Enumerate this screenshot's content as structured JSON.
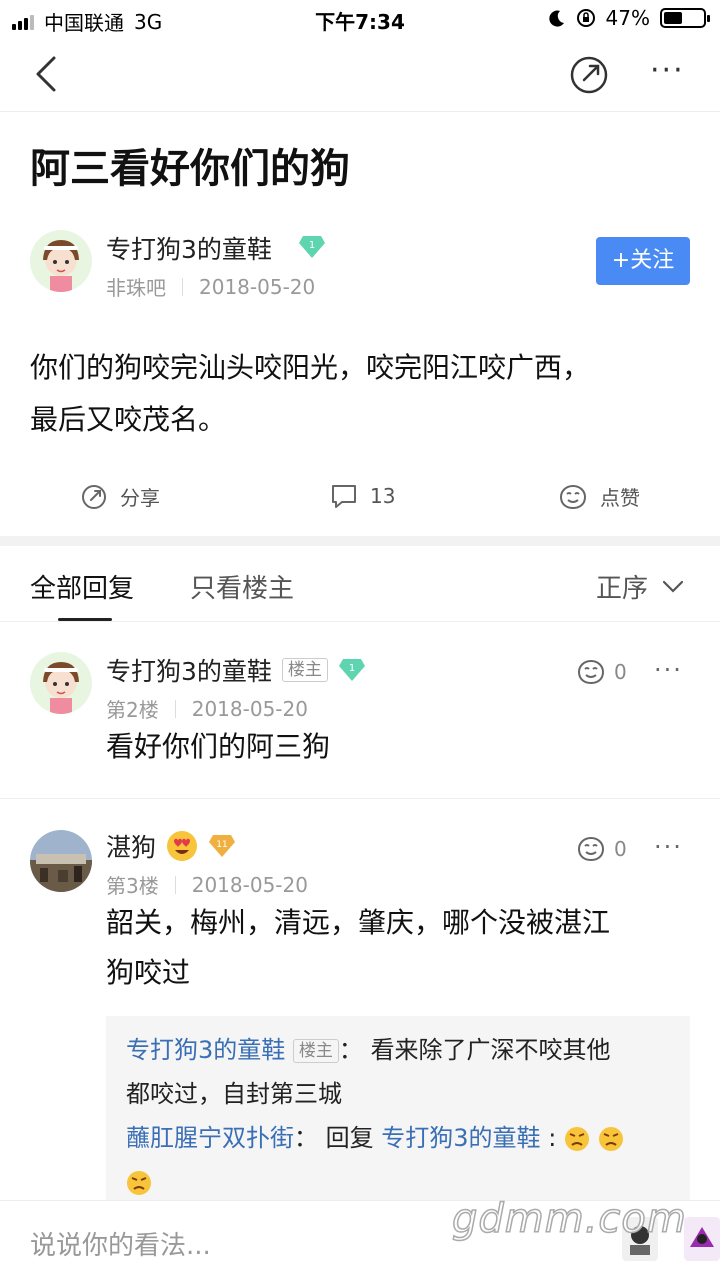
{
  "status_bar": {
    "carrier": "中国联通",
    "network": "3G",
    "time": "下午7:34",
    "battery": "47%",
    "battery_level": 0.47
  },
  "post": {
    "title": "阿三看好你们的狗",
    "author": "专打狗3的童鞋",
    "author_level": "1",
    "forum": "非珠吧",
    "date": "2018-05-20",
    "follow_label": "+关注",
    "body_line1": "你们的狗咬完汕头咬阳光，咬完阳江咬广西，",
    "body_line2": "最后又咬茂名。",
    "share_label": "分享",
    "comment_count": "13",
    "like_label": "点赞"
  },
  "tabs": {
    "all": "全部回复",
    "op_only": "只看楼主",
    "sort": "正序"
  },
  "replies": [
    {
      "author": "专打狗3的童鞋",
      "badge": "楼主",
      "level": "1",
      "floor": "第2楼",
      "date": "2018-05-20",
      "likes": "0",
      "text": "看好你们的阿三狗"
    },
    {
      "author": "湛狗",
      "level": "11",
      "floor": "第3楼",
      "date": "2018-05-20",
      "likes": "0",
      "text_line1": "韶关，梅州，清远，肇庆，哪个没被湛江",
      "text_line2": "狗咬过",
      "sub_replies": [
        {
          "author": "专打狗3的童鞋",
          "badge": "楼主",
          "sep": "：",
          "text_line1": "看来除了广深不咬其他",
          "text_line2": "都咬过，自封第三城"
        },
        {
          "author": "蘸肛腥宁双扑街",
          "sep": "：",
          "reply_prefix": "回复",
          "reply_to": "专打狗3的童鞋",
          "colon": ":"
        }
      ]
    }
  ],
  "input": {
    "placeholder": "说说你的看法..."
  },
  "watermark": "gdmm.com",
  "colors": {
    "accent": "#4a8af4",
    "link": "#3a6fb5",
    "diamond": "#5fd4b0",
    "gold": "#f0b040"
  }
}
